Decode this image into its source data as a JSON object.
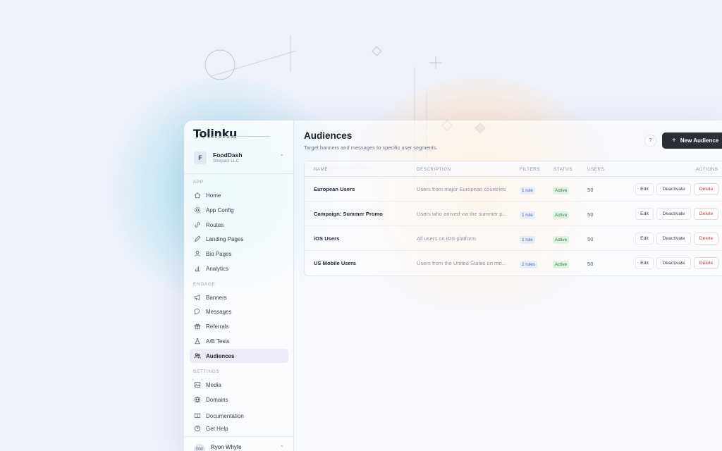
{
  "app": {
    "logo_text": "Tolinku",
    "workspace": {
      "initial": "F",
      "name": "FoodDash",
      "org": "Sitepact LLC"
    },
    "user": {
      "initials": "RW",
      "name": "Ryon Whyte"
    }
  },
  "sidebar": {
    "sections": [
      {
        "label": "APP",
        "items": [
          {
            "label": "Home",
            "icon": "home-icon"
          },
          {
            "label": "App Config",
            "icon": "gear-icon"
          },
          {
            "label": "Routes",
            "icon": "link-icon"
          },
          {
            "label": "Landing Pages",
            "icon": "pen-icon"
          },
          {
            "label": "Bio Pages",
            "icon": "person-icon"
          },
          {
            "label": "Analytics",
            "icon": "bar-chart-icon"
          }
        ]
      },
      {
        "label": "ENGAGE",
        "items": [
          {
            "label": "Banners",
            "icon": "megaphone-icon"
          },
          {
            "label": "Messages",
            "icon": "chat-icon"
          },
          {
            "label": "Referrals",
            "icon": "gift-icon"
          },
          {
            "label": "A/B Tests",
            "icon": "flask-icon"
          },
          {
            "label": "Audiences",
            "icon": "users-icon",
            "active": true
          }
        ]
      },
      {
        "label": "SETTINGS",
        "items": [
          {
            "label": "Media",
            "icon": "image-icon"
          },
          {
            "label": "Domains",
            "icon": "globe-icon"
          }
        ]
      }
    ],
    "footer_items": [
      {
        "label": "Documentation",
        "icon": "book-icon"
      },
      {
        "label": "Get Help",
        "icon": "help-circle-icon"
      }
    ]
  },
  "page": {
    "title": "Audiences",
    "subtitle": "Target banners and messages to specific user segments.",
    "help_label": "?",
    "new_button": "New Audience",
    "new_button_icon": "+"
  },
  "table": {
    "headers": {
      "name": "NAME",
      "description": "DESCRIPTION",
      "filters": "FILTERS",
      "status": "STATUS",
      "users": "USERS",
      "actions": "ACTIONS"
    },
    "rows": [
      {
        "name": "European Users",
        "description": "Users from major European countries",
        "filters": "1 rule",
        "status": "Active",
        "users": "50",
        "edit": "Edit",
        "deactivate": "Deactivate",
        "delete": "Delete"
      },
      {
        "name": "Campaign: Summer Promo",
        "description": "Users who arrived via the summer p...",
        "filters": "1 rule",
        "status": "Active",
        "users": "50",
        "edit": "Edit",
        "deactivate": "Deactivate",
        "delete": "Delete"
      },
      {
        "name": "iOS Users",
        "description": "All users on iOS platform",
        "filters": "1 rule",
        "status": "Active",
        "users": "50",
        "edit": "Edit",
        "deactivate": "Deactivate",
        "delete": "Delete"
      },
      {
        "name": "US Mobile Users",
        "description": "Users from the United States on mo...",
        "filters": "2 rules",
        "status": "Active",
        "users": "50",
        "edit": "Edit",
        "deactivate": "Deactivate",
        "delete": "Delete"
      }
    ]
  },
  "colors": {
    "primary_button": "#2b2e35",
    "active_badge_bg": "#dff3e4",
    "active_badge_text": "#2d7d45",
    "filter_badge_bg": "#e8edfa",
    "delete_text": "#d83a3a",
    "active_nav_bg": "#ecebf7"
  }
}
